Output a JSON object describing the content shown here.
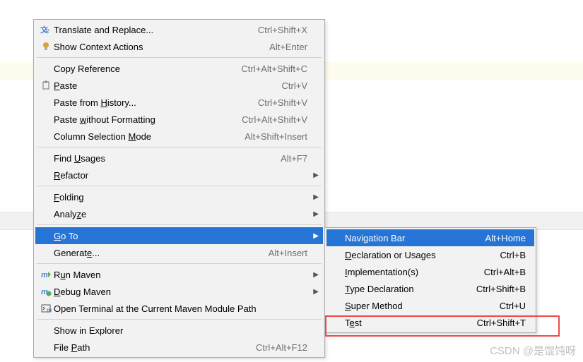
{
  "menu": {
    "translate": {
      "label": "Translate and Replace...",
      "shortcut": "Ctrl+Shift+X"
    },
    "context": {
      "label": "Show Context Actions",
      "shortcut": "Alt+Enter"
    },
    "copyref": {
      "label": "Copy Reference",
      "shortcut": "Ctrl+Alt+Shift+C"
    },
    "paste": {
      "pre": "",
      "u": "P",
      "post": "aste",
      "shortcut": "Ctrl+V"
    },
    "pastehist": {
      "pre": "Paste from ",
      "u": "H",
      "post": "istory...",
      "shortcut": "Ctrl+Shift+V"
    },
    "pastenofmt": {
      "pre": "Paste ",
      "u": "w",
      "post": "ithout Formatting",
      "shortcut": "Ctrl+Alt+Shift+V"
    },
    "colsel": {
      "pre": "Column Selection ",
      "u": "M",
      "post": "ode",
      "shortcut": "Alt+Shift+Insert"
    },
    "findusages": {
      "pre": "Find ",
      "u": "U",
      "post": "sages",
      "shortcut": "Alt+F7"
    },
    "refactor": {
      "pre": "",
      "u": "R",
      "post": "efactor"
    },
    "folding": {
      "pre": "",
      "u": "F",
      "post": "olding"
    },
    "analyze": {
      "pre": "Analy",
      "u": "z",
      "post": "e"
    },
    "goto": {
      "pre": "",
      "u": "G",
      "post": "o To"
    },
    "generate": {
      "pre": "Generat",
      "u": "e",
      "post": "...",
      "shortcut": "Alt+Insert"
    },
    "runmaven": {
      "pre": "R",
      "u": "u",
      "post": "n Maven"
    },
    "debugmaven": {
      "pre": "",
      "u": "D",
      "post": "ebug Maven"
    },
    "terminal": {
      "label": "Open Terminal at the Current Maven Module Path"
    },
    "explorer": {
      "label": "Show in Explorer"
    },
    "filepath": {
      "pre": "File ",
      "u": "P",
      "post": "ath",
      "shortcut": "Ctrl+Alt+F12"
    }
  },
  "submenu": {
    "navbar": {
      "label": "Navigation Bar",
      "shortcut": "Alt+Home"
    },
    "decl": {
      "pre": "",
      "u": "D",
      "post": "eclaration or Usages",
      "shortcut": "Ctrl+B"
    },
    "impl": {
      "pre": "",
      "u": "I",
      "post": "mplementation(s)",
      "shortcut": "Ctrl+Alt+B"
    },
    "typedec": {
      "pre": "",
      "u": "T",
      "post": "ype Declaration",
      "shortcut": "Ctrl+Shift+B"
    },
    "super": {
      "pre": "",
      "u": "S",
      "post": "uper Method",
      "shortcut": "Ctrl+U"
    },
    "test": {
      "pre": "T",
      "u": "e",
      "post": "st",
      "shortcut": "Ctrl+Shift+T"
    }
  },
  "watermark": "CSDN @是馄饨呀"
}
